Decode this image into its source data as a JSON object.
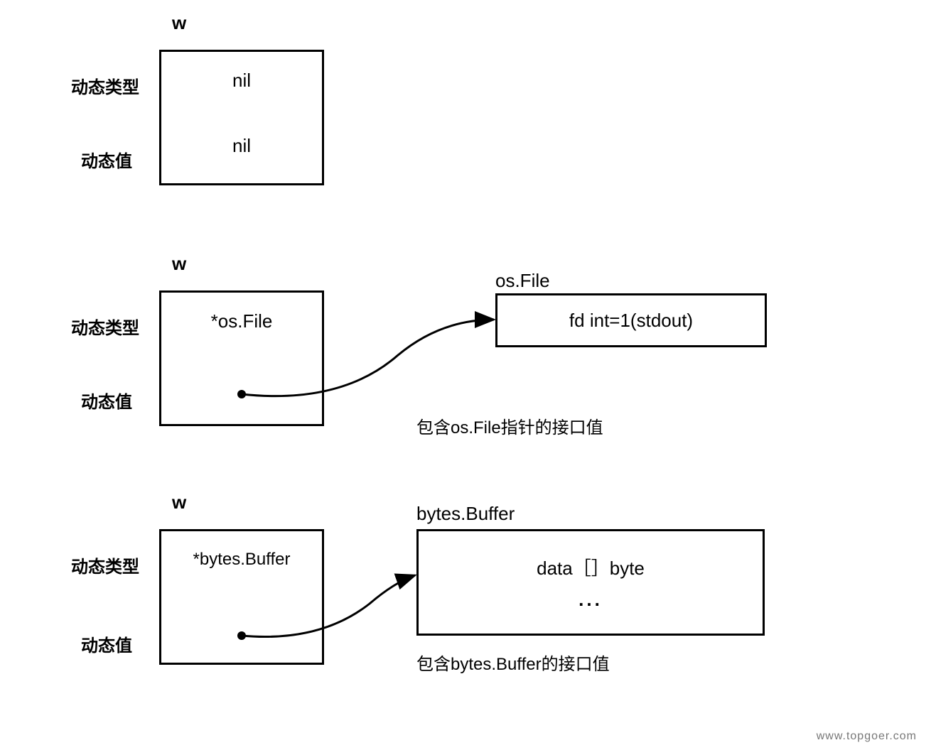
{
  "labels": {
    "w": "w",
    "dynamic_type": "动态类型",
    "dynamic_value": "动态值"
  },
  "section1": {
    "type_cell": "nil",
    "value_cell": "nil"
  },
  "section2": {
    "type_cell": "*os.File",
    "target_label": "os.File",
    "target_content": "fd int=1(stdout)",
    "caption": "包含os.File指针的接口值"
  },
  "section3": {
    "type_cell": "*bytes.Buffer",
    "target_label": "bytes.Buffer",
    "target_content1": "data［］byte",
    "target_content2": "...",
    "caption": "包含bytes.Buffer的接口值"
  },
  "watermark": "www.topgoer.com"
}
